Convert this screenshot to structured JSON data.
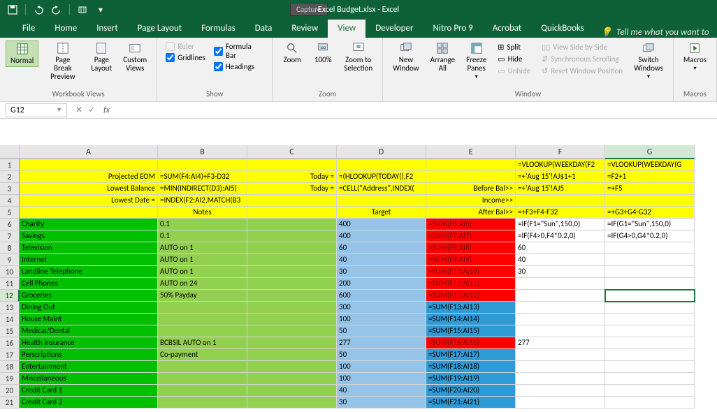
{
  "title": "Excel Budget.xlsx - Excel",
  "capture": "Capture",
  "tabs": [
    "File",
    "Home",
    "Insert",
    "Page Layout",
    "Formulas",
    "Data",
    "Review",
    "View",
    "Developer",
    "Nitro Pro 9",
    "Acrobat",
    "QuickBooks"
  ],
  "tell_me": "Tell me what you want to",
  "ribbon": {
    "wbviews": {
      "label": "Workbook Views",
      "normal": "Normal",
      "pagebreak": "Page Break\nPreview",
      "pagelayout": "Page\nLayout",
      "custom": "Custom\nViews"
    },
    "show": {
      "label": "Show",
      "ruler": "Ruler",
      "formula": "Formula Bar",
      "gridlines": "Gridlines",
      "headings": "Headings"
    },
    "zoom": {
      "label": "Zoom",
      "zoom": "Zoom",
      "hundred": "100%",
      "sel": "Zoom to\nSelection"
    },
    "window": {
      "label": "Window",
      "neww": "New\nWindow",
      "arrange": "Arrange\nAll",
      "freeze": "Freeze\nPanes",
      "split": "Split",
      "hide": "Hide",
      "unhide": "Unhide",
      "sidebyside": "View Side by Side",
      "sync": "Synchronous Scrolling",
      "reset": "Reset Window Position",
      "switch": "Switch\nWindows"
    },
    "macros": {
      "label": "Macros",
      "macros": "Macros"
    }
  },
  "name_box": "G12",
  "columns": [
    "A",
    "B",
    "C",
    "D",
    "E",
    "F",
    "G"
  ],
  "rows_numbers": [
    "1",
    "2",
    "3",
    "4",
    "5",
    "6",
    "7",
    "8",
    "9",
    "10",
    "11",
    "12",
    "13",
    "14",
    "15",
    "16",
    "17",
    "18",
    "19",
    "20",
    "21"
  ],
  "chart_data": {
    "type": "table",
    "rows": [
      {
        "r": 1,
        "A": "",
        "B": "",
        "C": "",
        "D": "",
        "E": "",
        "F": "=VLOOKUP(WEEKDAY(F2",
        "G": "=VLOOKUP(WEEKDAY(G"
      },
      {
        "r": 2,
        "A": "Projected EOM",
        "B": "=SUM(F4:AI4)+F3-D32",
        "C": "Today =",
        "D": "=(HLOOKUP(TODAY(),F2",
        "E": "",
        "F": "=+'Aug 15'!AJ$1+1",
        "G": "=F2+1"
      },
      {
        "r": 3,
        "A": "Lowest Balance",
        "B": "=MIN(INDIRECT(D3):AI5)",
        "C": "Today =",
        "D": "=CELL(\"Address\",INDEX(",
        "E": "Before Bal>>",
        "F": "=+'Aug 15'!AJ5",
        "G": "=+F5"
      },
      {
        "r": 4,
        "A": "Lowest Date =",
        "B": "=INDEX(F2:AI2,MATCH(B3",
        "C": "",
        "D": "",
        "E": "Income>>",
        "F": "",
        "G": ""
      },
      {
        "r": 5,
        "A": "",
        "B": "Notes",
        "C": "",
        "D": "Target",
        "E": "After Bal>>",
        "F": "=+F3+F4-F32",
        "G": "=+G3+G4-G32"
      },
      {
        "r": 6,
        "A": "Charity",
        "B": "0.1",
        "C": "",
        "D": "400",
        "E": "=SUM(F6:AI6)",
        "F": "=IF(F1=\"Sun\",150,0)",
        "G": "=IF(G1=\"Sun\",150,0)"
      },
      {
        "r": 7,
        "A": "Savings",
        "B": "0.1",
        "C": "",
        "D": "400",
        "E": "=SUM(F7:AI7)",
        "F": "=IF(F4>0,F4*0.2,0)",
        "G": "=IF(G4>0,G4*0.2,0)"
      },
      {
        "r": 8,
        "A": "Television",
        "B": "AUTO on 1",
        "C": "",
        "D": "60",
        "E": "=SUM(F8:AI8)",
        "F": "60",
        "G": ""
      },
      {
        "r": 9,
        "A": "Internet",
        "B": "AUTO on 1",
        "C": "",
        "D": "40",
        "E": "=SUM(F9:AI9)",
        "F": "40",
        "G": ""
      },
      {
        "r": 10,
        "A": "Landline Telephone",
        "B": "AUTO on 1",
        "C": "",
        "D": "30",
        "E": "=SUM(F10:AI10)",
        "F": "30",
        "G": ""
      },
      {
        "r": 11,
        "A": "Cell Phones",
        "B": "AUTO on 24",
        "C": "",
        "D": "200",
        "E": "=SUM(F11:AI11)",
        "F": "",
        "G": ""
      },
      {
        "r": 12,
        "A": "Groceries",
        "B": "50% Payday",
        "C": "",
        "D": "600",
        "E": "=SUM(F12:AI12)",
        "F": "",
        "G": ""
      },
      {
        "r": 13,
        "A": "Dining Out",
        "B": "",
        "C": "",
        "D": "300",
        "E": "=SUM(F13:AI13)",
        "F": "",
        "G": ""
      },
      {
        "r": 14,
        "A": "House Maint",
        "B": "",
        "C": "",
        "D": "100",
        "E": "=SUM(F14:AI14)",
        "F": "",
        "G": ""
      },
      {
        "r": 15,
        "A": "Medical/Dental",
        "B": "",
        "C": "",
        "D": "50",
        "E": "=SUM(F15:AI15)",
        "F": "",
        "G": ""
      },
      {
        "r": 16,
        "A": "Health Insurance",
        "B": "BCBSIL AUTO on 1",
        "C": "",
        "D": "277",
        "E": "=SUM(F16:AI16)",
        "F": "277",
        "G": ""
      },
      {
        "r": 17,
        "A": "Perscriptions",
        "B": "Co-payment",
        "C": "",
        "D": "50",
        "E": "=SUM(F17:AI17)",
        "F": "",
        "G": ""
      },
      {
        "r": 18,
        "A": "Entertainment",
        "B": "",
        "C": "",
        "D": "100",
        "E": "=SUM(F18:AI18)",
        "F": "",
        "G": ""
      },
      {
        "r": 19,
        "A": "Miscellaneous",
        "B": "",
        "C": "",
        "D": "100",
        "E": "=SUM(F19:AI19)",
        "F": "",
        "G": ""
      },
      {
        "r": 20,
        "A": "Credit Card 1",
        "B": "",
        "C": "",
        "D": "40",
        "E": "=SUM(F20:AI20)",
        "F": "",
        "G": ""
      },
      {
        "r": 21,
        "A": "Credit Card 2",
        "B": "",
        "C": "",
        "D": "30",
        "E": "=SUM(F21:AI21)",
        "F": "",
        "G": ""
      }
    ]
  }
}
